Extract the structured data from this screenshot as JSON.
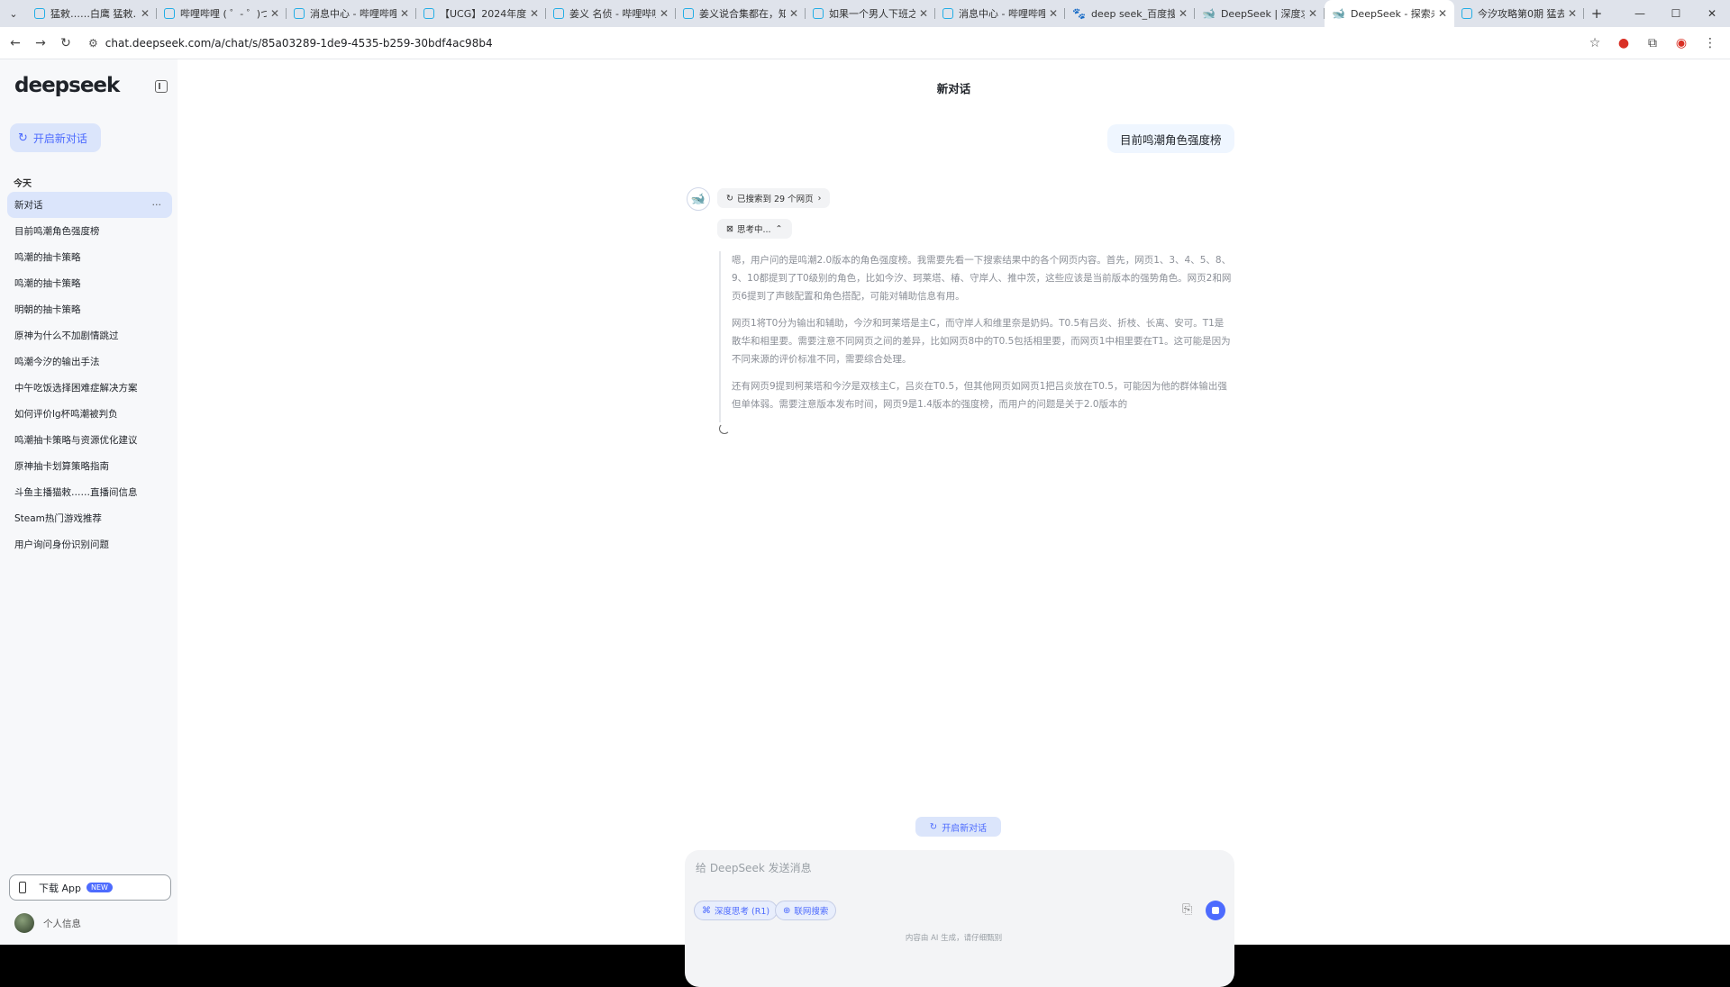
{
  "browser": {
    "tabs": [
      {
        "title": "猛敕……白鹰 猛敕……",
        "favicon": "tv-icon"
      },
      {
        "title": "哔哩哔哩 ( ゜- ゜)つロ",
        "favicon": "tv-icon"
      },
      {
        "title": "消息中心 - 哔哩哔哩弹",
        "favicon": "tv-icon"
      },
      {
        "title": "【UCG】2024年度十",
        "favicon": "tv-icon"
      },
      {
        "title": "姜义 名侦 - 哔哩哔哩 (",
        "favicon": "tv-icon"
      },
      {
        "title": "姜义说合集都在，知乎",
        "favicon": "tv-icon"
      },
      {
        "title": "如果一个男人下班之后",
        "favicon": "tv-icon"
      },
      {
        "title": "消息中心 - 哔哩哔哩弹",
        "favicon": "tv-icon"
      },
      {
        "title": "deep seek_百度搜索",
        "favicon": "paw-icon"
      },
      {
        "title": "DeepSeek | 深度求索",
        "favicon": "deepseek-icon"
      },
      {
        "title": "DeepSeek - 探索未至",
        "favicon": "deepseek-icon",
        "active": true
      },
      {
        "title": "今汐攻略第0期 猛去！",
        "favicon": "tv-icon"
      }
    ],
    "url": "chat.deepseek.com/a/chat/s/85a03289-1de9-4535-b259-30bdf4ac98b4"
  },
  "sidebar": {
    "logo": "deepseek",
    "new_chat": "开启新对话",
    "section_label": "今天",
    "items": [
      "新对话",
      "目前鸣潮角色强度榜",
      "鸣潮的抽卡策略",
      "鸣潮的抽卡策略",
      "明朝的抽卡策略",
      "原神为什么不加剧情跳过",
      "鸣潮今汐的输出手法",
      "中午吃饭选择困难症解决方案",
      "如何评价lg杯鸣潮被判负",
      "鸣潮抽卡策略与资源优化建议",
      "原神抽卡划算策略指南",
      "斗鱼主播猫敕……直播间信息",
      "Steam热门游戏推荐",
      "用户询问身份识别问题"
    ],
    "download_app": "下载 App",
    "new_badge": "NEW",
    "profile": "个人信息"
  },
  "main": {
    "title": "新对话",
    "user_message": "目前鸣潮角色强度榜",
    "search_status": "已搜索到 29 个网页",
    "thinking_status": "思考中...",
    "thinking": [
      "嗯，用户问的是鸣潮2.0版本的角色强度榜。我需要先看一下搜索结果中的各个网页内容。首先，网页1、3、4、5、8、9、10都提到了T0级别的角色，比如今汐、珂莱塔、椿、守岸人、推中茨，这些应该是当前版本的强势角色。网页2和网页6提到了声骸配置和角色搭配，可能对辅助信息有用。",
      "网页1将T0分为输出和辅助，今汐和珂莱塔是主C，而守岸人和维里奈是奶妈。T0.5有吕炎、折枝、长离、安可。T1是散华和相里要。需要注意不同网页之间的差异，比如网页8中的T0.5包括相里要，而网页1中相里要在T1。这可能是因为不同来源的评价标准不同，需要综合处理。",
      "还有网页9提到柯莱塔和今汐是双核主C，吕炎在T0.5，但其他网页如网页1把吕炎放在T0.5，可能因为他的群体输出强但单体弱。需要注意版本发布时间，网页9是1.4版本的强度榜，而用户的问题是关于2.0版本的"
    ],
    "new_chat_button": "开启新对话",
    "composer": {
      "placeholder": "给 DeepSeek 发送消息",
      "deep_think": "深度思考 (R1)",
      "web_search": "联网搜索"
    },
    "disclaimer": "内容由 AI 生成，请仔细甄别"
  },
  "colors": {
    "accent": "#4d6bfe",
    "selected": "#dbe5fb",
    "sidebar_bg": "#f7f8fa"
  }
}
